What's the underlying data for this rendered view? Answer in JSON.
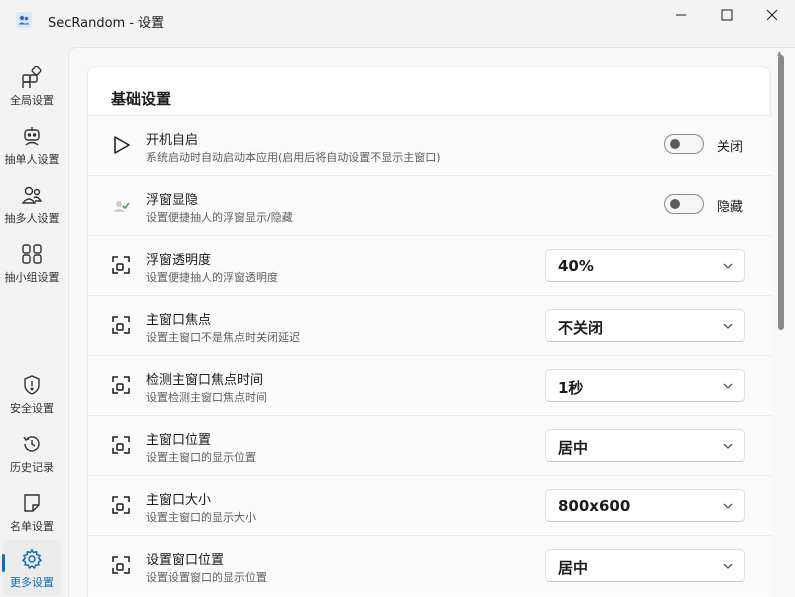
{
  "window": {
    "title": "SecRandom - 设置"
  },
  "sidebar": {
    "items": [
      {
        "label": "全局设置",
        "icon": "apps-icon"
      },
      {
        "label": "抽单人设置",
        "icon": "bot-icon"
      },
      {
        "label": "抽多人设置",
        "icon": "people-icon"
      },
      {
        "label": "抽小组设置",
        "icon": "group-icon"
      },
      {
        "label": "安全设置",
        "icon": "shield-icon"
      },
      {
        "label": "历史记录",
        "icon": "history-icon"
      },
      {
        "label": "名单设置",
        "icon": "note-icon"
      },
      {
        "label": "更多设置",
        "icon": "gear-icon",
        "active": true
      }
    ]
  },
  "card": {
    "title": "基础设置",
    "rows": [
      {
        "title": "开机自启",
        "desc": "系统启动时自动启动本应用(启用后将自动设置不显示主窗口)",
        "control": "toggle",
        "state_label": "关闭",
        "on": false,
        "icon": "play-icon"
      },
      {
        "title": "浮窗显隐",
        "desc": "设置便捷抽人的浮窗显示/隐藏",
        "control": "toggle",
        "state_label": "隐藏",
        "on": false,
        "icon": "float-window-icon"
      },
      {
        "title": "浮窗透明度",
        "desc": "设置便捷抽人的浮窗透明度",
        "control": "select",
        "value": "40%",
        "icon": "resize-icon"
      },
      {
        "title": "主窗口焦点",
        "desc": "设置主窗口不是焦点时关闭延迟",
        "control": "select",
        "value": "不关闭",
        "icon": "resize-icon"
      },
      {
        "title": "检测主窗口焦点时间",
        "desc": "设置检测主窗口焦点时间",
        "control": "select",
        "value": "1秒",
        "icon": "resize-icon"
      },
      {
        "title": "主窗口位置",
        "desc": "设置主窗口的显示位置",
        "control": "select",
        "value": "居中",
        "icon": "resize-icon"
      },
      {
        "title": "主窗口大小",
        "desc": "设置主窗口的显示大小",
        "control": "select",
        "value": "800x600",
        "icon": "resize-icon"
      },
      {
        "title": "设置窗口位置",
        "desc": "设置设置窗口的显示位置",
        "control": "select",
        "value": "居中",
        "icon": "resize-icon"
      }
    ]
  },
  "colors": {
    "accent": "#0f6cbd",
    "background": "#f3f3f3",
    "card": "#ffffff"
  }
}
